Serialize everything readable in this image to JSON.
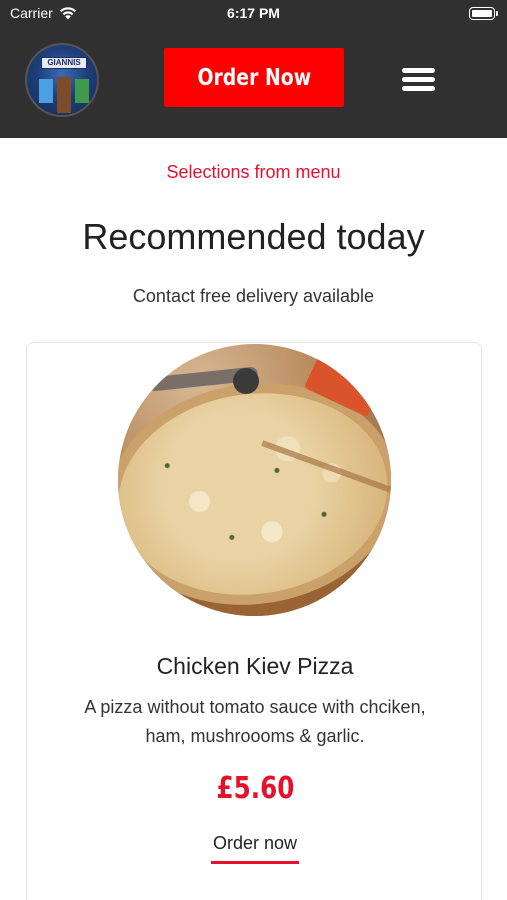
{
  "status_bar": {
    "carrier": "Carrier",
    "time": "6:17 PM",
    "icons": [
      "wifi-icon",
      "battery-icon"
    ]
  },
  "header": {
    "logo_alt": "store-logo",
    "logo_sign": "GIANNIS",
    "order_button_label": "Order Now",
    "menu_icon": "hamburger-menu-icon"
  },
  "section": {
    "eyebrow": "Selections from menu",
    "title": "Recommended today",
    "subtitle": "Contact free delivery available"
  },
  "item": {
    "name": "Chicken Kiev Pizza",
    "description": "A pizza without tomato sauce with chciken, ham, mushroooms & garlic.",
    "price": "£5.60",
    "cta_label": "Order now"
  },
  "colors": {
    "header_bg": "#303030",
    "accent_red": "#ff0000",
    "text_red": "#e8112d"
  }
}
